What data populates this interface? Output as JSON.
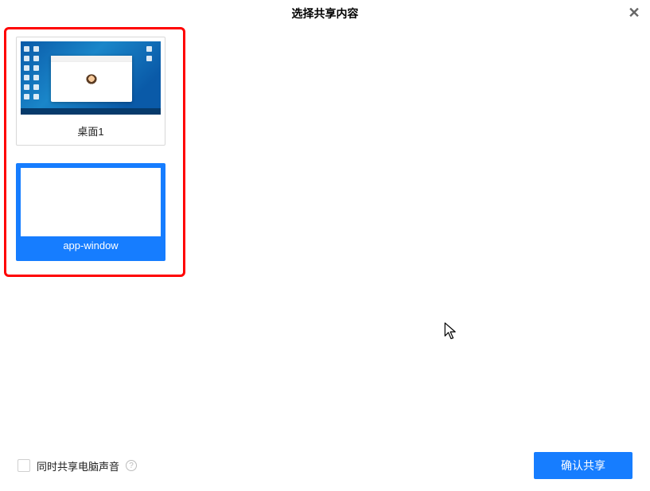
{
  "header": {
    "title": "选择共享内容"
  },
  "sources": [
    {
      "label": "桌面1",
      "kind": "desktop",
      "selected": false
    },
    {
      "label": "app-window",
      "kind": "window",
      "selected": true
    }
  ],
  "footer": {
    "share_audio_label": "同时共享电脑声音",
    "confirm_label": "确认共享"
  },
  "colors": {
    "accent": "#167dff",
    "highlight": "#ff0000"
  }
}
